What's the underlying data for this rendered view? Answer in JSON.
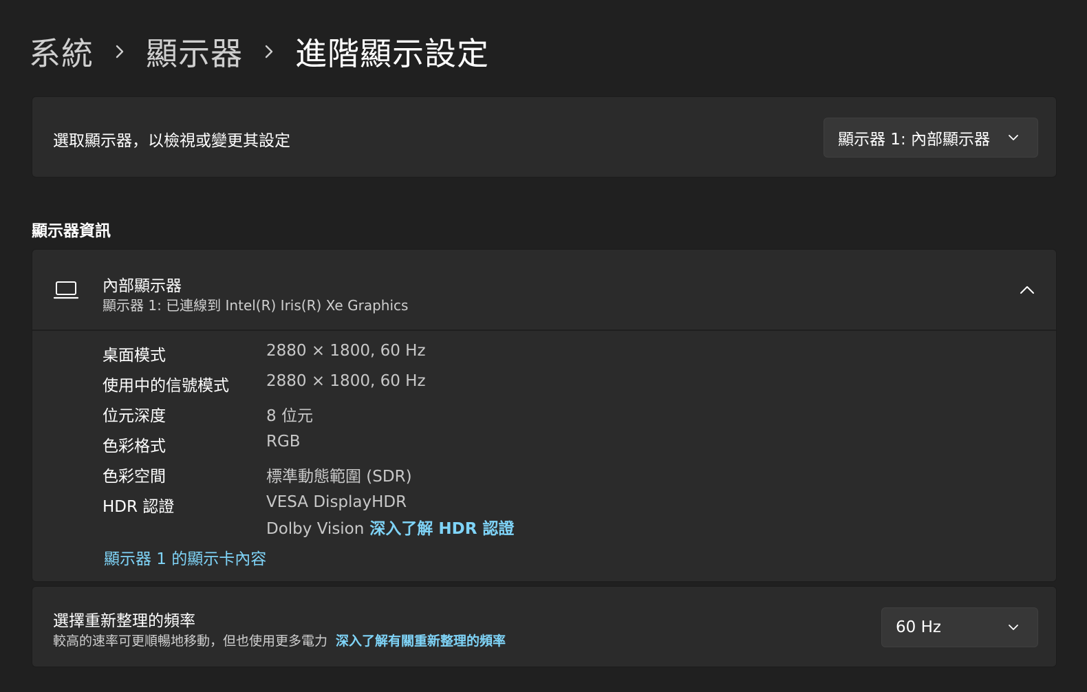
{
  "breadcrumb": {
    "items": [
      "系統",
      "顯示器",
      "進階顯示設定"
    ]
  },
  "select_display": {
    "label": "選取顯示器，以檢視或變更其設定",
    "selected": "顯示器 1: 內部顯示器"
  },
  "section": {
    "title": "顯示器資訊"
  },
  "display_info": {
    "icon": "laptop-icon",
    "title": "內部顯示器",
    "subtitle": "顯示器 1: 已連線到 Intel(R) Iris(R) Xe Graphics",
    "rows": [
      {
        "key": "桌面模式",
        "value": "2880 × 1800, 60 Hz"
      },
      {
        "key": "使用中的信號模式",
        "value": "2880 × 1800, 60 Hz"
      },
      {
        "key": "位元深度",
        "value": "8 位元"
      },
      {
        "key": "色彩格式",
        "value": "RGB"
      },
      {
        "key": "色彩空間",
        "value": "標準動態範圍 (SDR)"
      },
      {
        "key": "HDR 認證",
        "value": "VESA DisplayHDR"
      }
    ],
    "hdr_extra_value": "Dolby Vision",
    "hdr_link": "深入了解 HDR 認證",
    "adapter_link": "顯示器 1 的顯示卡內容"
  },
  "refresh_rate": {
    "title": "選擇重新整理的頻率",
    "description": "較高的速率可更順暢地移動，但也使用更多電力",
    "link": "深入了解有關重新整理的頻率",
    "selected": "60 Hz"
  },
  "colors": {
    "background": "#202020",
    "card": "#2b2b2b",
    "link": "#7fd4f8"
  }
}
